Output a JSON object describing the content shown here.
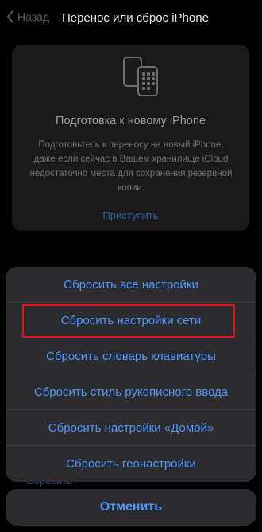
{
  "nav": {
    "back_label": "Назад",
    "title": "Перенос или сброс iPhone"
  },
  "card": {
    "icon": "two-phones-icon",
    "title": "Подготовка к новому iPhone",
    "description": "Подготовьтесь к переносу на новый iPhone, даже если сейчас в Вашем хранилище iCloud недостаточно места для сохранения резервной копии.",
    "link_label": "Приступить"
  },
  "background_link": "Сбросить",
  "action_sheet": {
    "items": [
      {
        "label": "Сбросить все настройки"
      },
      {
        "label": "Сбросить настройки сети"
      },
      {
        "label": "Сбросить словарь клавиатуры"
      },
      {
        "label": "Сбросить стиль рукописного ввода"
      },
      {
        "label": "Сбросить настройки «Домой»"
      },
      {
        "label": "Сбросить геонастройки"
      }
    ],
    "cancel_label": "Отменить"
  },
  "colors": {
    "accent": "#4d97ff",
    "highlight": "#e0141a",
    "sheet_bg": "#2c2c2e"
  }
}
